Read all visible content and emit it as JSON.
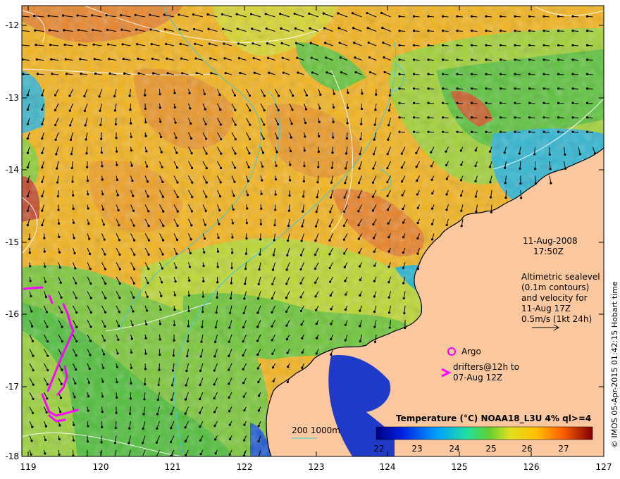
{
  "map": {
    "lon_ticks": [
      "119",
      "120",
      "121",
      "122",
      "123",
      "124",
      "125",
      "126",
      "127"
    ],
    "lat_ticks": [
      "-12",
      "-13",
      "-14",
      "-15",
      "-16",
      "-17",
      "-18"
    ],
    "date_line1": "11-Aug-2008",
    "date_line2": "17:50Z",
    "legend_lines": [
      "Altimetric sealevel",
      "(0.1m contours)",
      "and velocity for",
      "11-Aug 17Z",
      "0.5m/s (1kt 24h)"
    ],
    "argo_label": "Argo",
    "drifters_line1": "drifters@12h to",
    "drifters_line2": "07-Aug 12Z",
    "depth_label": "200  1000m",
    "colorbar_title": "Temperature (°C) NOAA18_L3U 4% ql>=4",
    "colorbar_ticks": [
      "22",
      "23",
      "24",
      "25",
      "26",
      "27"
    ],
    "side_credit": "© IMOS 05-Apr-2015 01:42:15 Hobart time",
    "colors": {
      "land": "#fbc79e",
      "warm": "#f7b21a",
      "orange": "#ef8c21",
      "yellow": "#e6dc2e",
      "green": "#62c63a",
      "cyan": "#23b4d8",
      "blue": "#1a3ccf",
      "magenta": "#ff00ff"
    }
  }
}
